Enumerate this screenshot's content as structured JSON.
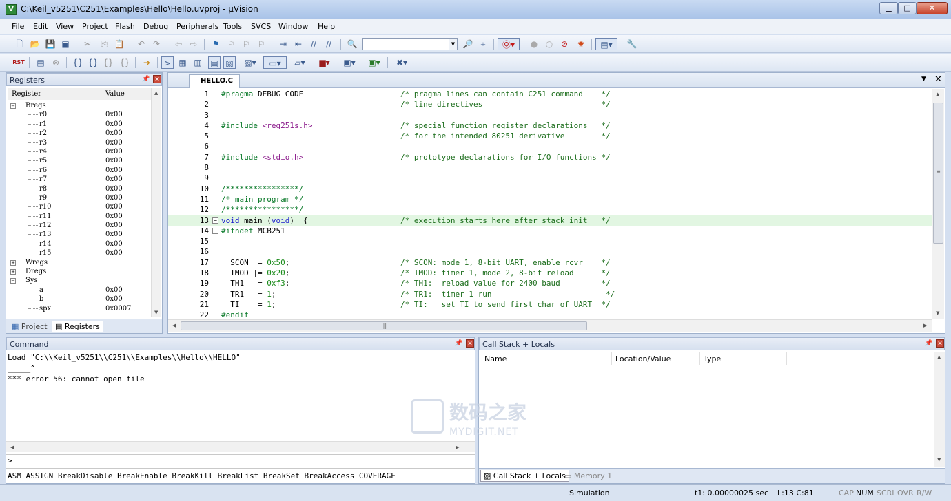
{
  "window": {
    "title": "C:\\Keil_v5251\\C251\\Examples\\Hello\\Hello.uvproj - µVision"
  },
  "menu": [
    "File",
    "Edit",
    "View",
    "Project",
    "Flash",
    "Debug",
    "Peripherals",
    "Tools",
    "SVCS",
    "Window",
    "Help"
  ],
  "registers": {
    "title": "Registers",
    "col_register": "Register",
    "col_value": "Value",
    "rows": [
      {
        "name": "Bregs",
        "value": "",
        "level": 0,
        "expander": "−"
      },
      {
        "name": "r0",
        "value": "0x00",
        "level": 1
      },
      {
        "name": "r1",
        "value": "0x00",
        "level": 1
      },
      {
        "name": "r2",
        "value": "0x00",
        "level": 1
      },
      {
        "name": "r3",
        "value": "0x00",
        "level": 1
      },
      {
        "name": "r4",
        "value": "0x00",
        "level": 1
      },
      {
        "name": "r5",
        "value": "0x00",
        "level": 1
      },
      {
        "name": "r6",
        "value": "0x00",
        "level": 1
      },
      {
        "name": "r7",
        "value": "0x00",
        "level": 1
      },
      {
        "name": "r8",
        "value": "0x00",
        "level": 1
      },
      {
        "name": "r9",
        "value": "0x00",
        "level": 1
      },
      {
        "name": "r10",
        "value": "0x00",
        "level": 1
      },
      {
        "name": "r11",
        "value": "0x00",
        "level": 1
      },
      {
        "name": "r12",
        "value": "0x00",
        "level": 1
      },
      {
        "name": "r13",
        "value": "0x00",
        "level": 1
      },
      {
        "name": "r14",
        "value": "0x00",
        "level": 1
      },
      {
        "name": "r15",
        "value": "0x00",
        "level": 1
      },
      {
        "name": "Wregs",
        "value": "",
        "level": 0,
        "expander": "+"
      },
      {
        "name": "Dregs",
        "value": "",
        "level": 0,
        "expander": "+"
      },
      {
        "name": "Sys",
        "value": "",
        "level": 0,
        "expander": "−"
      },
      {
        "name": "a",
        "value": "0x00",
        "level": 1
      },
      {
        "name": "b",
        "value": "0x00",
        "level": 1
      },
      {
        "name": "spx",
        "value": "0x0007",
        "level": 1
      }
    ],
    "tabs": [
      "Project",
      "Registers"
    ]
  },
  "editor": {
    "file_tab": "HELLO.C",
    "lines": [
      {
        "n": "1",
        "code": [
          [
            "pp",
            "#pragma"
          ],
          [
            "",
            " DEBUG CODE"
          ]
        ],
        "comment": "/* pragma lines can contain C251 command    */"
      },
      {
        "n": "2",
        "code": [],
        "comment": "/* line directives                          */"
      },
      {
        "n": "3",
        "code": [],
        "comment": ""
      },
      {
        "n": "4",
        "code": [
          [
            "pp",
            "#include"
          ],
          [
            "",
            " "
          ],
          [
            "str",
            "<reg251s.h>"
          ]
        ],
        "comment": "/* special function register declarations   */"
      },
      {
        "n": "5",
        "code": [],
        "comment": "/* for the intended 80251 derivative        */"
      },
      {
        "n": "6",
        "code": [],
        "comment": ""
      },
      {
        "n": "7",
        "code": [
          [
            "pp",
            "#include"
          ],
          [
            "",
            " "
          ],
          [
            "str",
            "<stdio.h>"
          ]
        ],
        "comment": "/* prototype declarations for I/O functions */"
      },
      {
        "n": "8",
        "code": [],
        "comment": ""
      },
      {
        "n": "9",
        "code": [],
        "comment": ""
      },
      {
        "n": "10",
        "code": [
          [
            "pp",
            "/****************/"
          ]
        ],
        "comment": ""
      },
      {
        "n": "11",
        "code": [
          [
            "pp",
            "/* main program */"
          ]
        ],
        "comment": ""
      },
      {
        "n": "12",
        "code": [
          [
            "pp",
            "/****************/"
          ]
        ],
        "comment": ""
      },
      {
        "n": "13",
        "code": [
          [
            "kw",
            "void"
          ],
          [
            "",
            " main ("
          ],
          [
            "kw",
            "void"
          ],
          [
            "",
            ")  {"
          ]
        ],
        "comment": "/* execution starts here after stack init   */",
        "fold": "−",
        "highlight": true
      },
      {
        "n": "14",
        "code": [
          [
            "pp",
            "#ifndef"
          ],
          [
            "",
            " MCB251"
          ]
        ],
        "comment": "",
        "fold": "−"
      },
      {
        "n": "15",
        "code": [],
        "comment": ""
      },
      {
        "n": "16",
        "code": [],
        "comment": ""
      },
      {
        "n": "17",
        "code": [
          [
            "",
            "  SCON  = "
          ],
          [
            "num",
            "0x50"
          ],
          [
            "",
            ";"
          ]
        ],
        "comment": "/* SCON: mode 1, 8-bit UART, enable rcvr    */"
      },
      {
        "n": "18",
        "code": [
          [
            "",
            "  TMOD |= "
          ],
          [
            "num",
            "0x20"
          ],
          [
            "",
            ";"
          ]
        ],
        "comment": "/* TMOD: timer 1, mode 2, 8-bit reload      */"
      },
      {
        "n": "19",
        "code": [
          [
            "",
            "  TH1   = "
          ],
          [
            "num",
            "0xf3"
          ],
          [
            "",
            ";"
          ]
        ],
        "comment": "/* TH1:  reload value for 2400 baud         */"
      },
      {
        "n": "20",
        "code": [
          [
            "",
            "  TR1   = "
          ],
          [
            "num",
            "1"
          ],
          [
            "",
            ";"
          ]
        ],
        "comment": "/* TR1:  timer 1 run                         */"
      },
      {
        "n": "21",
        "code": [
          [
            "",
            "  TI    = "
          ],
          [
            "num",
            "1"
          ],
          [
            "",
            ";"
          ]
        ],
        "comment": "/* TI:   set TI to send first char of UART  */"
      },
      {
        "n": "22",
        "code": [
          [
            "pp",
            "#endif"
          ]
        ],
        "comment": ""
      }
    ]
  },
  "command": {
    "title": "Command",
    "output": [
      "Load \"C:\\\\Keil_v5251\\\\C251\\\\Examples\\\\Hello\\\\HELLO\"",
      "_____^",
      "*** error 56: cannot open file"
    ],
    "prompt": ">",
    "keywords": "ASM ASSIGN BreakDisable BreakEnable BreakKill BreakList BreakSet BreakAccess COVERAGE"
  },
  "callstack": {
    "title": "Call Stack + Locals",
    "columns": [
      "Name",
      "Location/Value",
      "Type"
    ],
    "tabs": [
      "Call Stack + Locals",
      "Memory 1"
    ]
  },
  "status": {
    "mode": "Simulation",
    "time": "t1: 0.00000025 sec",
    "position": "L:13 C:81",
    "indicators": [
      "CAP",
      "NUM",
      "SCRL",
      "OVR",
      "R/W"
    ],
    "active_indicator": "NUM"
  },
  "watermark": {
    "brand_cn": "数码之家",
    "brand_en": "MYDIGIT.NET"
  }
}
